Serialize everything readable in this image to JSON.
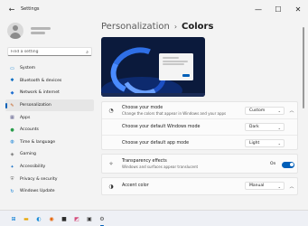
{
  "window": {
    "title": "Settings",
    "controls": [
      "—",
      "☐",
      "✕"
    ]
  },
  "sidebar": {
    "search_placeholder": "Find a setting",
    "items": [
      {
        "label": "System",
        "icon": "system-icon",
        "glyph": "▭",
        "color": "#0078d4"
      },
      {
        "label": "Bluetooth & devices",
        "icon": "bluetooth-icon",
        "glyph": "✱",
        "color": "#0067c0"
      },
      {
        "label": "Network & internet",
        "icon": "network-icon",
        "glyph": "◆",
        "color": "#1f6fd1"
      },
      {
        "label": "Personalization",
        "icon": "brush-icon",
        "glyph": "✎",
        "color": "#c25b1a"
      },
      {
        "label": "Apps",
        "icon": "apps-icon",
        "glyph": "▦",
        "color": "#5c5c8a"
      },
      {
        "label": "Accounts",
        "icon": "accounts-icon",
        "glyph": "●",
        "color": "#2a9d4b"
      },
      {
        "label": "Time & language",
        "icon": "globe-icon",
        "glyph": "◍",
        "color": "#0078d4"
      },
      {
        "label": "Gaming",
        "icon": "gaming-icon",
        "glyph": "◈",
        "color": "#6b6b6b"
      },
      {
        "label": "Accessibility",
        "icon": "accessibility-icon",
        "glyph": "✦",
        "color": "#1a73c8"
      },
      {
        "label": "Privacy & security",
        "icon": "shield-icon",
        "glyph": "⛨",
        "color": "#6b6b6b"
      },
      {
        "label": "Windows Update",
        "icon": "update-icon",
        "glyph": "↻",
        "color": "#0078d4"
      }
    ],
    "active_index": 3
  },
  "main": {
    "breadcrumb_parent": "Personalization",
    "breadcrumb_sep": "›",
    "breadcrumb_current": "Colors",
    "mode": {
      "title": "Choose your mode",
      "subtitle": "Change the colors that appear in Windows and your apps",
      "value": "Custom",
      "expand_glyph": "︿"
    },
    "windows_mode": {
      "title": "Choose your default Windows mode",
      "value": "Dark"
    },
    "app_mode": {
      "title": "Choose your default app mode",
      "value": "Light"
    },
    "transparency": {
      "title": "Transparency effects",
      "subtitle": "Windows and surfaces appear translucent",
      "state": "On"
    },
    "accent": {
      "title": "Accent color",
      "value": "Manual",
      "expand_glyph": "︿"
    }
  },
  "taskbar": {
    "items": [
      {
        "icon": "windows-start-icon",
        "glyph": "⊞",
        "color": "#0078d4"
      },
      {
        "icon": "file-explorer-icon",
        "glyph": "▬",
        "color": "#e8a500"
      },
      {
        "icon": "edge-icon",
        "glyph": "◐",
        "color": "#1a8cd8"
      },
      {
        "icon": "firefox-icon",
        "glyph": "◉",
        "color": "#e66000"
      },
      {
        "icon": "app-icon",
        "glyph": "■",
        "color": "#2b2b2b"
      },
      {
        "icon": "photos-icon",
        "glyph": "◩",
        "color": "#d44a7a"
      },
      {
        "icon": "terminal-icon",
        "glyph": "▣",
        "color": "#333333"
      },
      {
        "icon": "settings-icon",
        "glyph": "⚙",
        "color": "#4a4a4a"
      }
    ],
    "active_index": 7
  },
  "colors": {
    "accent": "#005fb8",
    "background": "#f3f3f3",
    "card": "#fbfbfb"
  }
}
